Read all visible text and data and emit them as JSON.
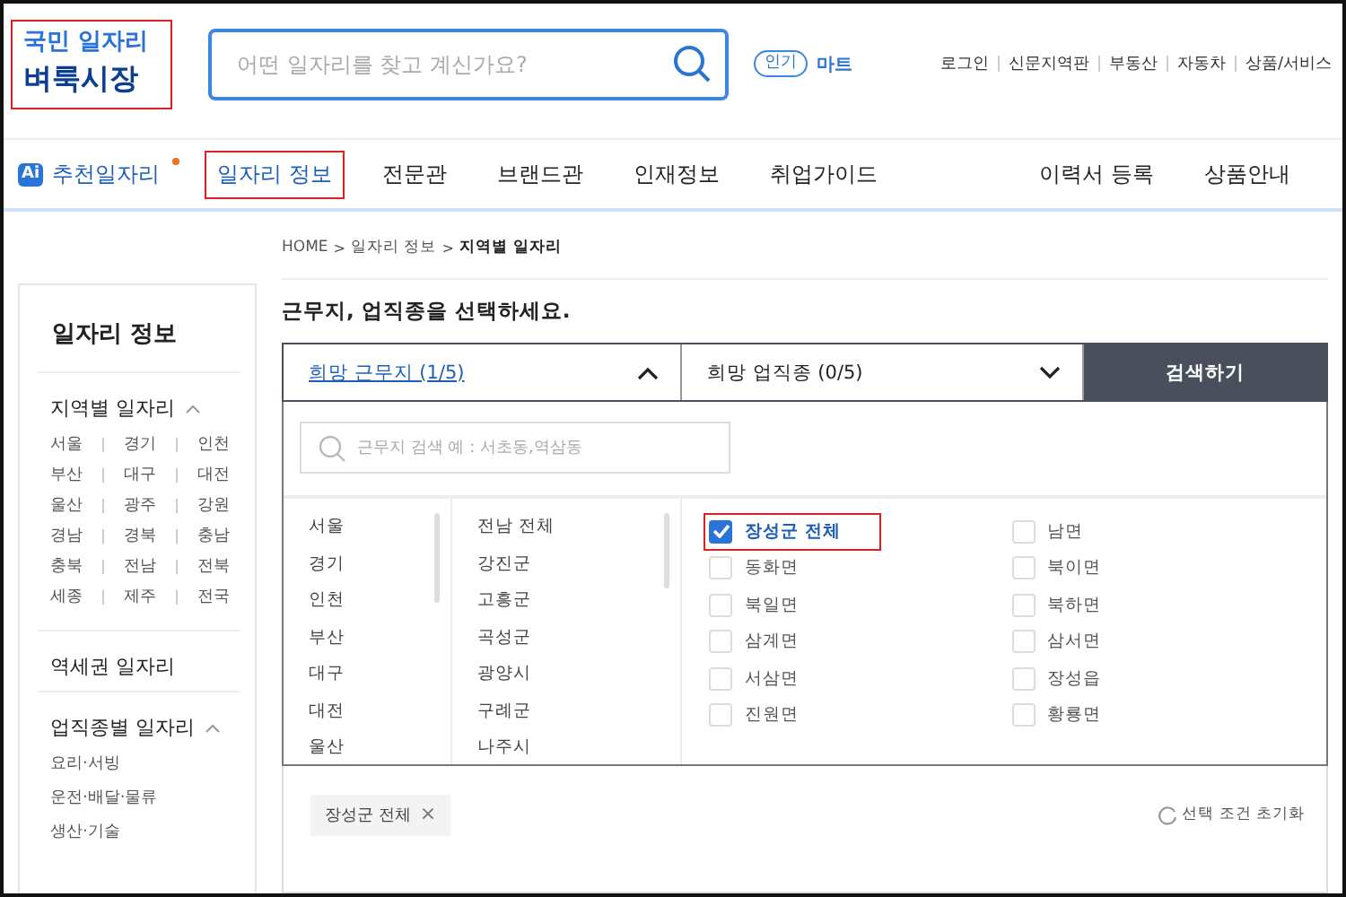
{
  "header": {
    "logo": {
      "line1": "국민 일자리",
      "line2": "벼룩시장",
      "highlighted": true
    },
    "search": {
      "placeholder": "어떤 일자리를 찾고 계신가요?"
    },
    "popular": {
      "badge": "인기",
      "keyword": "마트"
    },
    "links": [
      "로그인",
      "신문지역판",
      "부동산",
      "자동차",
      "상품/서비스"
    ]
  },
  "nav": {
    "ai_badge": "Ai",
    "recommend": "추천일자리",
    "items": [
      {
        "label": "일자리 정보",
        "highlighted": true
      },
      {
        "label": "전문관",
        "highlighted": false
      },
      {
        "label": "브랜드관",
        "highlighted": false
      },
      {
        "label": "인재정보",
        "highlighted": false
      },
      {
        "label": "취업가이드",
        "highlighted": false
      }
    ],
    "right": [
      "이력서 등록",
      "상품안내"
    ]
  },
  "sidebar": {
    "title": "일자리 정보",
    "sections": [
      {
        "title": "지역별 일자리",
        "expanded": true,
        "grid": [
          "서울",
          "경기",
          "인천",
          "부산",
          "대구",
          "대전",
          "울산",
          "광주",
          "강원",
          "경남",
          "경북",
          "충남",
          "충북",
          "전남",
          "전북",
          "세종",
          "제주",
          "전국"
        ]
      },
      {
        "title": "역세권 일자리",
        "expanded": false
      },
      {
        "title": "업직종별 일자리",
        "expanded": true,
        "list": [
          "요리·서빙",
          "운전·배달·물류",
          "생산·기술"
        ]
      }
    ]
  },
  "breadcrumb": [
    {
      "label": "HOME",
      "current": false
    },
    {
      "separator": ">",
      "label": "일자리 정보",
      "current": false
    },
    {
      "separator": ">",
      "label": "지역별 일자리",
      "current": true
    }
  ],
  "heading": "근무지, 업직종을 선택하세요.",
  "tabs": [
    {
      "label": "희망 근무지 (1/5)",
      "selected": true
    },
    {
      "label": "희망 업직종 (0/5)",
      "selected": false
    }
  ],
  "search_button": "검색하기",
  "area_search": {
    "placeholder": "근무지 검색 예 : 서초동,역삼동"
  },
  "regions": [
    "서울",
    "경기",
    "인천",
    "부산",
    "대구",
    "대전",
    "울산"
  ],
  "districts": [
    "전남 전체",
    "강진군",
    "고흥군",
    "곡성군",
    "광양시",
    "구례군",
    "나주시"
  ],
  "towns": [
    {
      "label": "장성군 전체",
      "checked": true,
      "highlighted": true
    },
    {
      "label": "남면",
      "checked": false,
      "highlighted": false
    },
    {
      "label": "동화면",
      "checked": false,
      "highlighted": false
    },
    {
      "label": "북이면",
      "checked": false,
      "highlighted": false
    },
    {
      "label": "북일면",
      "checked": false,
      "highlighted": false
    },
    {
      "label": "북하면",
      "checked": false,
      "highlighted": false
    },
    {
      "label": "삼계면",
      "checked": false,
      "highlighted": false
    },
    {
      "label": "삼서면",
      "checked": false,
      "highlighted": false
    },
    {
      "label": "서삼면",
      "checked": false,
      "highlighted": false
    },
    {
      "label": "장성읍",
      "checked": false,
      "highlighted": false
    },
    {
      "label": "진원면",
      "checked": false,
      "highlighted": false
    },
    {
      "label": "황룡면",
      "checked": false,
      "highlighted": false
    }
  ],
  "chips": [
    {
      "label": "장성군 전체",
      "close": "×"
    }
  ],
  "reset": "선택 조건 초기화"
}
